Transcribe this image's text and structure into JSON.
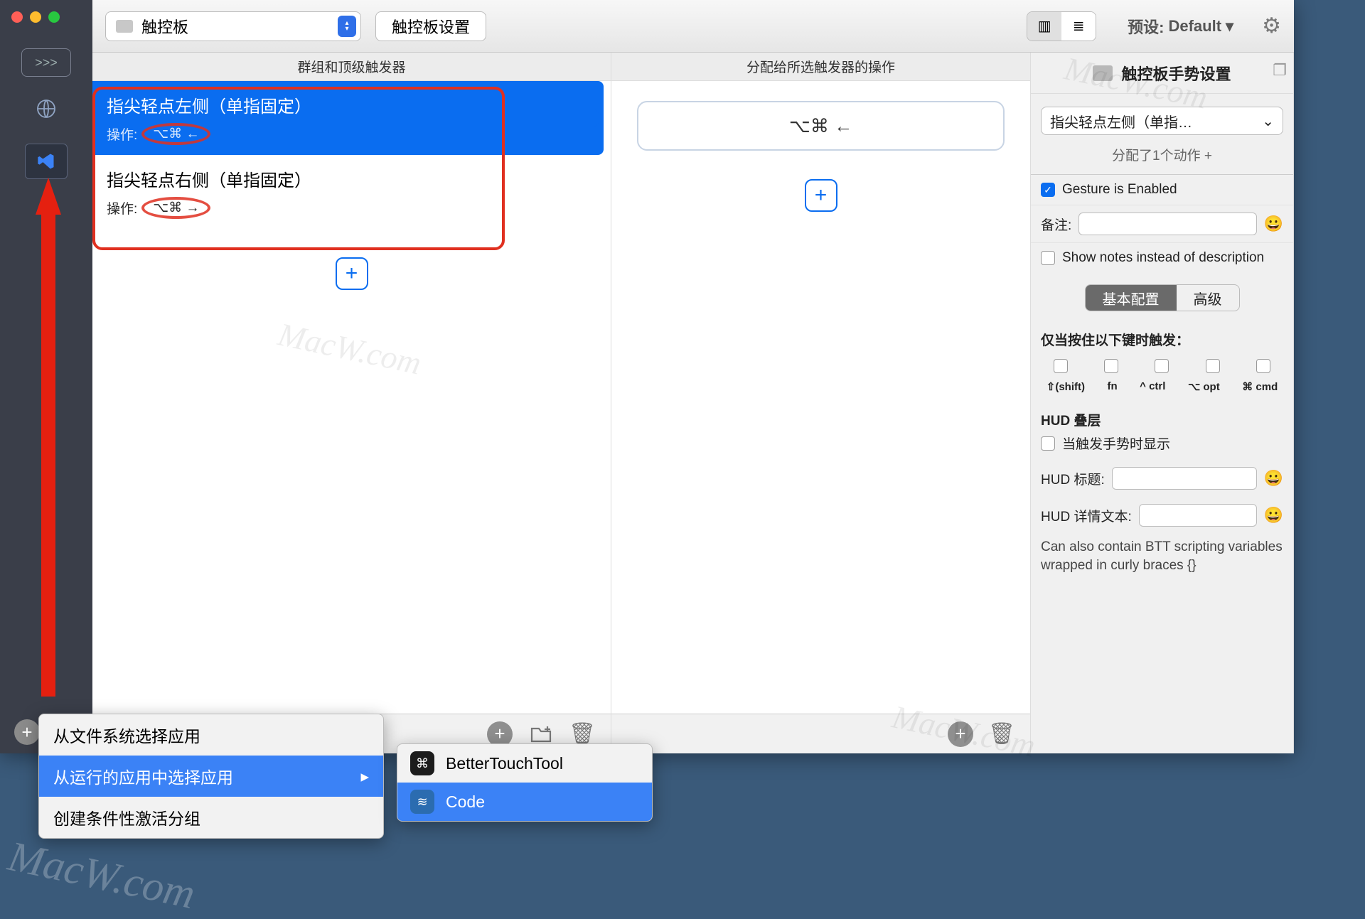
{
  "toolbar": {
    "device_select": "触控板",
    "settings_button": "触控板设置",
    "preset_label": "预设:",
    "preset_value": "Default",
    "preset_caret": "▾"
  },
  "columns": {
    "triggers_header": "群组和顶级触发器",
    "actions_header": "分配给所选触发器的操作"
  },
  "triggers": [
    {
      "title": "指尖轻点左侧（单指固定）",
      "action_prefix": "操作:",
      "shortcut": "⌥⌘ ←",
      "selected": true
    },
    {
      "title": "指尖轻点右侧（单指固定）",
      "action_prefix": "操作:",
      "shortcut": "⌥⌘ →",
      "selected": false
    }
  ],
  "action_pill": "⌥⌘ ←",
  "inspector": {
    "title": "触控板手势设置",
    "gesture_select": "指尖轻点左侧（单指…",
    "gesture_caret": "⌄",
    "assigned": "分配了1个动作 +",
    "enabled_label": "Gesture is Enabled",
    "enabled_checked": true,
    "notes_label": "备注:",
    "show_notes_label": "Show notes instead of description",
    "seg_basic": "基本配置",
    "seg_adv": "高级",
    "mods_title": "仅当按住以下键时触发：",
    "mods": [
      "⇧(shift)",
      "fn",
      "^ ctrl",
      "⌥ opt",
      "⌘ cmd"
    ],
    "hud_header": "HUD 叠层",
    "hud_show_label": "当触发手势时显示",
    "hud_title_label": "HUD 标题:",
    "hud_detail_label": "HUD 详情文本:",
    "hud_note": "Can also contain BTT scripting variables wrapped in curly braces {}"
  },
  "context_menu": {
    "items": [
      {
        "label": "从文件系统选择应用",
        "selected": false
      },
      {
        "label": "从运行的应用中选择应用",
        "selected": true,
        "submenu": true
      },
      {
        "label": "创建条件性激活分组",
        "selected": false
      }
    ]
  },
  "sub_menu": {
    "items": [
      {
        "label": "BetterTouchTool",
        "icon_bg": "#1c1c1c",
        "icon_glyph": "⌘",
        "selected": false
      },
      {
        "label": "Code",
        "icon_bg": "#2b6cb0",
        "icon_glyph": "≋",
        "selected": true
      }
    ]
  },
  "glyphs": {
    "plus": "+",
    "arrow_right": "▸",
    "trash": "🗑",
    "folder_plus": "📁⁺",
    "emoji": "😀",
    "shortcut_btn": ">>>",
    "list": "≣",
    "columns": "▥",
    "gear": "⚙"
  },
  "watermark": "MacW.com"
}
